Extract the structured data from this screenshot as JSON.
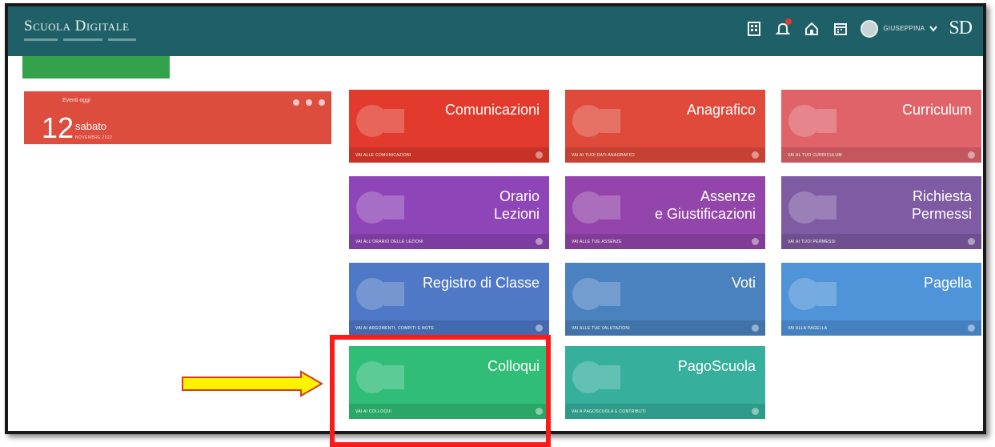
{
  "app": {
    "brand": "Scuola Digitale",
    "logo_mark": "SD",
    "user_name": "GIUSEPPINA"
  },
  "topbar_icons": [
    "building-icon",
    "bell-icon",
    "home-icon",
    "calendar-icon"
  ],
  "agenda": {
    "event_label": "Eventi oggi",
    "day": "12",
    "weekday": "sabato",
    "month_year": "NOVEMBRE 2022"
  },
  "tiles": [
    {
      "name": "comunicazioni",
      "title": "Comunicazioni",
      "link": "VAI ALLE COMUNICAZIONI",
      "color": "#e23a2c"
    },
    {
      "name": "anagrafico",
      "title": "Anagrafico",
      "link": "VAI AI TUOI DATI ANAGRAFICI",
      "color": "#e04a3b"
    },
    {
      "name": "curriculum",
      "title": "Curriculum",
      "link": "VAI AL TUO CURRICULUM",
      "color": "#e0636a"
    },
    {
      "name": "orario-lezioni",
      "title": "Orario\nLezioni",
      "link": "VAI ALL'ORARIO DELLE LEZIONI",
      "color": "#8e45b7"
    },
    {
      "name": "assenze",
      "title": "Assenze\ne Giustificazioni",
      "link": "VAI ALLE TUE ASSENZE",
      "color": "#9345ab"
    },
    {
      "name": "richiesta-permessi",
      "title": "Richiesta\nPermessi",
      "link": "VAI AI TUOI PERMESSI",
      "color": "#7f5ba3"
    },
    {
      "name": "registro-classe",
      "title": "Registro di Classe",
      "link": "VAI AI ARGOMENTI, COMPITI E NOTE",
      "color": "#4f78c6"
    },
    {
      "name": "voti",
      "title": "Voti",
      "link": "VAI ALLE TUE VALUTAZIONI",
      "color": "#4a82c0"
    },
    {
      "name": "pagella",
      "title": "Pagella",
      "link": "VAI ALLA PAGELLA",
      "color": "#4f93d9"
    },
    {
      "name": "colloqui",
      "title": "Colloqui",
      "link": "VAI AI COLLOQUI",
      "color": "#2fbd77"
    },
    {
      "name": "pagoscuola",
      "title": "PagoScuola",
      "link": "VAI A PAGOSCUOLA E CONTRIBUTI",
      "color": "#36b09c"
    }
  ]
}
